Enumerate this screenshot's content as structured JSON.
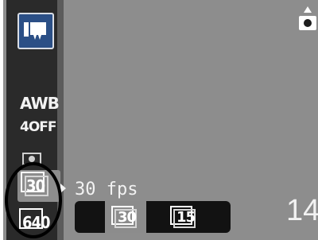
{
  "camera": {
    "mode": {
      "icon": "movie-mode-icon"
    },
    "white_balance": "AWB",
    "flash": "4OFF",
    "selected_size": {
      "icon": "image-size-30-icon",
      "label": "30"
    },
    "size_options_left": [
      "30",
      "640"
    ],
    "frame_rate_label": "30 fps",
    "frame_rate_options": [
      "30",
      "15"
    ],
    "frame_rate_selected": "30",
    "shots_remaining": "14\"",
    "record_icon": "record-icon"
  },
  "colors": {
    "background": "#8d8d8d",
    "sidebar": "#2a2a2a",
    "mode_blue": "#2b4f86",
    "bar": "#121212",
    "text": "#f2f2f2"
  }
}
